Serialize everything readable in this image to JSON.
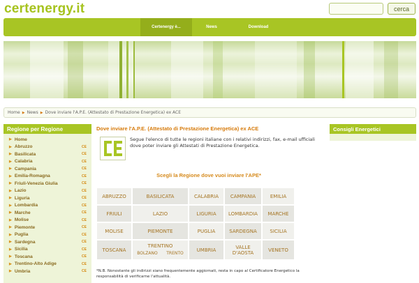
{
  "site": {
    "logo": "certenergy.it"
  },
  "search": {
    "placeholder": "",
    "value": "",
    "button_label": "cerca"
  },
  "nav": {
    "items": [
      "Certenergy è...",
      "News",
      "Download"
    ],
    "active": 0
  },
  "breadcrumb": {
    "items": [
      "Home",
      "News",
      "Dove inviare l'A.P.E. (Attestato di Prestazione Energetica) ex ACE"
    ]
  },
  "sidebar": {
    "title": "Regione per Regione",
    "items": [
      {
        "label": "Home",
        "badge": ""
      },
      {
        "label": "Abruzzo",
        "badge": "CE"
      },
      {
        "label": "Basilicata",
        "badge": "CE"
      },
      {
        "label": "Calabria",
        "badge": "CE"
      },
      {
        "label": "Campania",
        "badge": "CE"
      },
      {
        "label": "Emilia-Romagna",
        "badge": "CE"
      },
      {
        "label": "Friuli-Venezia Giulia",
        "badge": "CE"
      },
      {
        "label": "Lazio",
        "badge": "CE"
      },
      {
        "label": "Liguria",
        "badge": "CE"
      },
      {
        "label": "Lombardia",
        "badge": "CE"
      },
      {
        "label": "Marche",
        "badge": "CE"
      },
      {
        "label": "Molise",
        "badge": "CE"
      },
      {
        "label": "Piemonte",
        "badge": "CE"
      },
      {
        "label": "Puglia",
        "badge": "CE"
      },
      {
        "label": "Sardegna",
        "badge": "CE"
      },
      {
        "label": "Sicilia",
        "badge": "CE"
      },
      {
        "label": "Toscana",
        "badge": "CE"
      },
      {
        "label": "Trentino-Alto Adige",
        "badge": "CE"
      },
      {
        "label": "Umbria",
        "badge": "CE"
      }
    ]
  },
  "main": {
    "title": "Dove inviare l'A.P.E. (Attestato di Prestazione Energetica) ex ACE",
    "logo_text": "CE",
    "intro": "Segue l'elenco di tutte le regioni italiane con i relativi indirizzi, fax, e-mail ufficiali dove poter inviare gli Attestati di Prestazione Energetica.",
    "choose": "Scegli la Regione dove vuoi inviare l'APE*",
    "regions": [
      [
        "ABRUZZO",
        "BASILICATA",
        "CALABRIA",
        "CAMPANIA",
        "EMILIA"
      ],
      [
        "FRIULI",
        "LAZIO",
        "LIGURIA",
        "LOMBARDIA",
        "MARCHE"
      ],
      [
        "MOLISE",
        "PIEMONTE",
        "PUGLIA",
        "SARDEGNA",
        "SICILIA"
      ],
      [
        "TOSCANA",
        "TRENTINO",
        "UMBRIA",
        "VALLE D'AOSTA",
        "VENETO"
      ]
    ],
    "trentino_sub": [
      "BOLZANO",
      "TRENTO"
    ],
    "note": "*N.B. Nonostante gli indirizzi siano frequentemente aggiornati, resta in capo al Certificatore Energetico la responsabilità di verificarne l'attualità."
  },
  "right": {
    "title": "Consigli Energetici"
  },
  "colors": {
    "brand_green": "#a8c524",
    "accent_orange": "#d67a0a",
    "region_text": "#a57422"
  }
}
